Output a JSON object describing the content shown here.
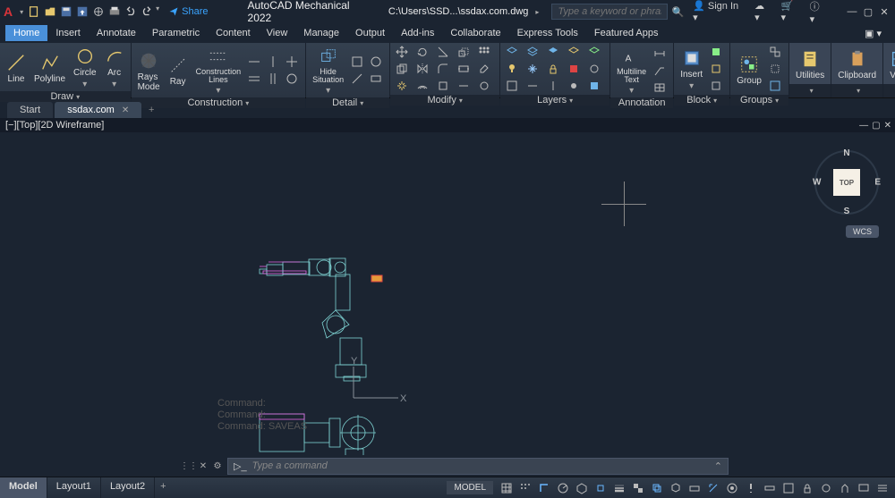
{
  "title": {
    "app": "AutoCAD Mechanical 2022",
    "path": "C:\\Users\\SSD...\\ssdax.com.dwg"
  },
  "share_label": "Share",
  "search_placeholder": "Type a keyword or phrase",
  "signin": "Sign In",
  "menu": [
    "Home",
    "Insert",
    "Annotate",
    "Parametric",
    "Content",
    "View",
    "Manage",
    "Output",
    "Add-ins",
    "Collaborate",
    "Express Tools",
    "Featured Apps"
  ],
  "menu_active": 0,
  "ribbon": {
    "draw": {
      "label": "Draw",
      "items": [
        "Line",
        "Polyline",
        "Circle",
        "Arc"
      ]
    },
    "construct": {
      "label": "Construction",
      "rays": "Rays",
      "mode": "Mode",
      "ray": "Ray",
      "clines": "Construction\nLines",
      "hide": "Hide\nSituation"
    },
    "detail": "Detail",
    "modify": "Modify",
    "layers": "Layers",
    "mtext": "Multiline\nText",
    "annotation": "Annotation",
    "insert": "Insert",
    "block": "Block",
    "group": "Group",
    "groups": "Groups",
    "utilities": "Utilities",
    "clipboard": "Clipboard",
    "view": "View"
  },
  "doc_tabs": {
    "start": "Start",
    "file": "ssdax.com"
  },
  "vp_label": "[−][Top][2D Wireframe]",
  "viewcube": {
    "top": "TOP",
    "n": "N",
    "s": "S",
    "e": "E",
    "w": "W",
    "wcs": "WCS"
  },
  "cmd_placeholder": "Type a command",
  "cmd_history": [
    "Command:",
    "Command:",
    "Command:  SAVEAS"
  ],
  "layouts": [
    "Model",
    "Layout1",
    "Layout2"
  ],
  "layouts_active": 0,
  "status_model": "MODEL",
  "ucs": {
    "x": "X",
    "y": "Y"
  }
}
